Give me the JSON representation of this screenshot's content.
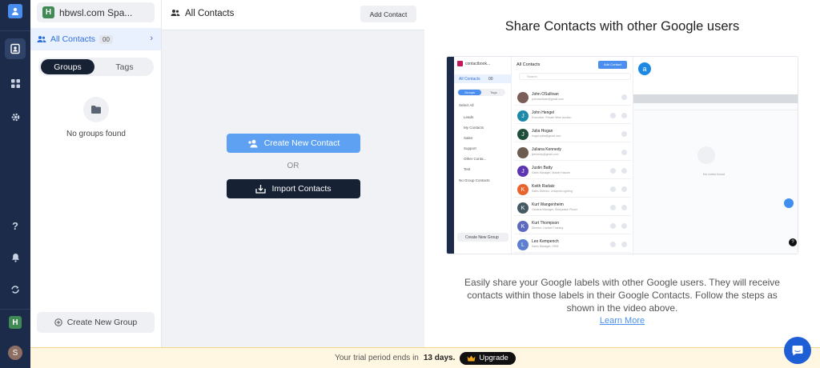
{
  "workspace": {
    "name": "hbwsl.com Spa...",
    "icon_letter": "H"
  },
  "rail": {
    "items": [
      "contacts-icon",
      "apps-icon",
      "settings-icon",
      "help-icon",
      "notifications-icon",
      "sync-icon"
    ],
    "avatar_letter": "S"
  },
  "sidebar": {
    "all_contacts_label": "All Contacts",
    "all_contacts_count": "00",
    "tabs": [
      "Groups",
      "Tags"
    ],
    "active_tab": "Groups",
    "empty_text": "No groups found",
    "create_group_label": "Create New Group"
  },
  "contacts_panel": {
    "title": "All Contacts",
    "add_contact_label": "Add Contact",
    "create_new_contact_label": "Create New Contact",
    "or_label": "OR",
    "import_contacts_label": "Import Contacts"
  },
  "share": {
    "title": "Share Contacts with other Google users",
    "description": "Easily share your Google labels with other Google users. They will receive contacts within those labels in their Google Contacts. Follow the steps as shown in the video above.",
    "learn_more_label": "Learn More"
  },
  "video": {
    "app_name": "contactbook...",
    "header": "All Contacts",
    "add_contact": "Add Contact",
    "search_placeholder": "Search",
    "all_contacts": "All Contacts",
    "all_contacts_count": "00",
    "tabs": [
      "Groups",
      "Tags"
    ],
    "select_all": "Select All",
    "groups": [
      {
        "name": "Leads",
        "count": "00"
      },
      {
        "name": "My Contacts",
        "count": "00"
      },
      {
        "name": "Sales",
        "count": "00"
      },
      {
        "name": "Support",
        "count": "00"
      },
      {
        "name": "Other Conta...",
        "count": "00"
      },
      {
        "name": "Test",
        "count": "00"
      },
      {
        "name": "No Group Contacts",
        "count": "00"
      }
    ],
    "create_group": "Create New Group",
    "contacts": [
      {
        "name": "John OSullivan",
        "sub": "johnosullivan@gmail.com",
        "color": "#7b5e57",
        "letter": ""
      },
      {
        "name": "John Hengel",
        "sub": "Executive, Private Wine Auction",
        "color": "#1e88a8",
        "letter": "J"
      },
      {
        "name": "Julia Hogan",
        "sub": "hogan.julia@gmail.com",
        "color": "#1f4f3a",
        "letter": "J"
      },
      {
        "name": "Juliana Kennedy",
        "sub": "jkennedy@gmail.com",
        "color": "#6d5c50",
        "letter": ""
      },
      {
        "name": "Justin Batty",
        "sub": "Sales Manager, Master Hauser",
        "color": "#5e35b1",
        "letter": "J"
      },
      {
        "name": "Keith Radatz",
        "sub": "Sales Director, Lindqvist Lighting",
        "color": "#e8642c",
        "letter": "K"
      },
      {
        "name": "Kurt Wangenheim",
        "sub": "General Manager, Stonywave Phone",
        "color": "#455a64",
        "letter": "K"
      },
      {
        "name": "Kurt Thompson",
        "sub": "Director, Lindwel Training",
        "color": "#5c6bc0",
        "letter": "K"
      },
      {
        "name": "Leo Kempench",
        "sub": "Sales Manager, GRM",
        "color": "#5e7fd0",
        "letter": "L"
      }
    ],
    "detail_avatar": "a",
    "no_notes": "No notes found"
  },
  "banner": {
    "prefix": "Your trial period ends in",
    "days": "13 days.",
    "upgrade_label": "Upgrade"
  },
  "colors": {
    "rail_bg": "#1c2b4a",
    "accent": "#5ea1f2",
    "dark_button": "#172134",
    "banner_bg": "#fff7e2",
    "chat_button": "#1f5fd6"
  }
}
